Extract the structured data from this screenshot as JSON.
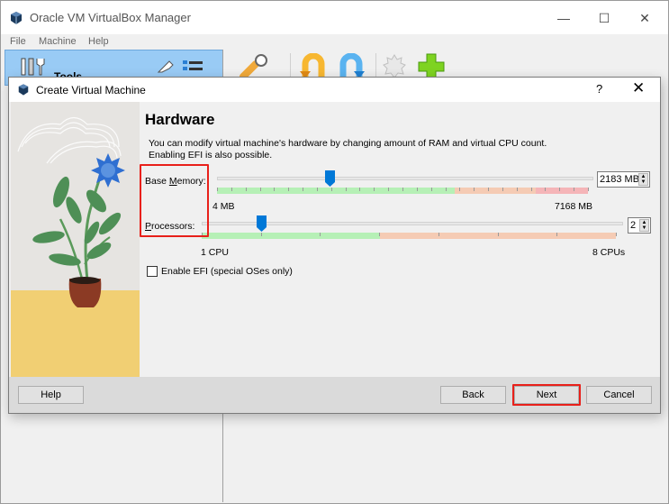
{
  "main_window": {
    "title": "Oracle VM VirtualBox Manager",
    "controls": {
      "minimize": "—",
      "maximize": "☐",
      "close": "✕"
    },
    "menu": [
      "File",
      "Machine",
      "Help"
    ],
    "tools_label": "Tools",
    "toolbar_icons": [
      "preferences-icon",
      "import-icon",
      "export-icon",
      "extensions-icon",
      "new-icon"
    ]
  },
  "dialog": {
    "title": "Create Virtual Machine",
    "help_glyph": "?",
    "close_glyph": "✕",
    "page_title": "Hardware",
    "description": "You can modify virtual machine's hardware by changing amount of RAM and virtual CPU count. Enabling EFI is also possible.",
    "memory": {
      "label": "Base Memory:",
      "mnemonic": "M",
      "value": 2183,
      "value_text": "2183 MB",
      "min": 4,
      "max": 7168,
      "min_label": "4 MB",
      "max_label": "7168 MB",
      "zones": {
        "green_until": 0.64,
        "orange_until": 0.86,
        "red_until": 1.0
      },
      "ticks": 27
    },
    "processors": {
      "label": "Processors:",
      "mnemonic": "P",
      "value": 2,
      "value_text": "2",
      "min": 1,
      "max": 8,
      "min_label": "1 CPU",
      "max_label": "8 CPUs",
      "zones": {
        "green_until": 0.43,
        "orange_until": 1.0
      }
    },
    "efi": {
      "label": "Enable EFI (special OSes only)",
      "checked": false
    },
    "buttons": {
      "help": "Help",
      "back": "Back",
      "next": "Next",
      "cancel": "Cancel"
    },
    "colors": {
      "green": "#b6f0b6",
      "orange": "#f5cbb4",
      "red": "#f5b5b8",
      "handle": "#0078d7",
      "annotation": "#e8201a"
    }
  }
}
